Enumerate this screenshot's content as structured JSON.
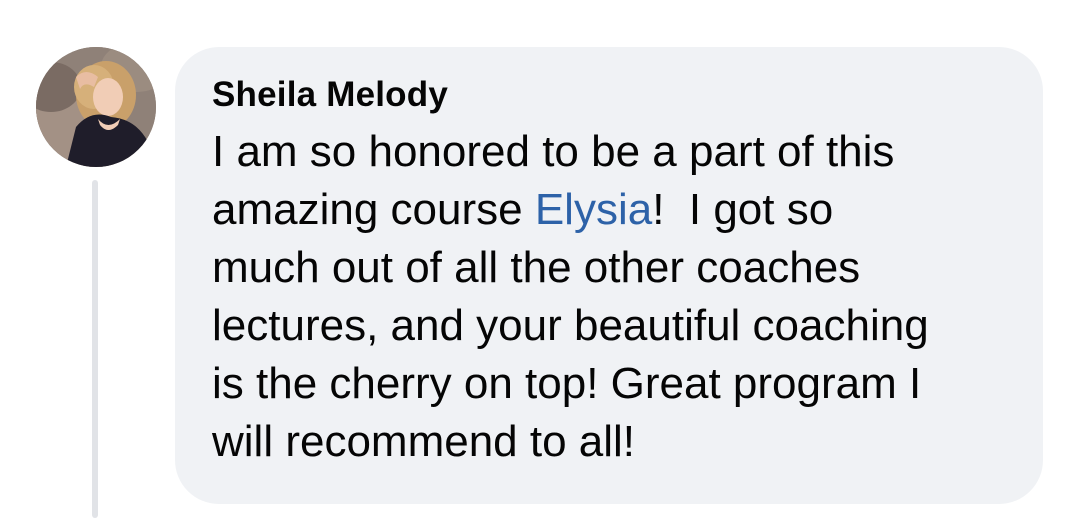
{
  "comment": {
    "author_name": "Sheila Melody",
    "text_lines": [
      "I am so honored to be a part of this",
      [
        "amazing course ",
        "Elysia",
        "!  I got so"
      ],
      "much out of all the other coaches",
      "lectures, and your beautiful coaching",
      "is the cherry on top! Great program I",
      "will recommend to all!"
    ]
  },
  "mention": {
    "name": "Elysia",
    "color": "#2d62a8"
  },
  "colors": {
    "bubble_background": "#f0f2f5",
    "text": "#050505",
    "thread_line": "#e1e3e7"
  },
  "avatar": {
    "icon": "profile-photo"
  }
}
